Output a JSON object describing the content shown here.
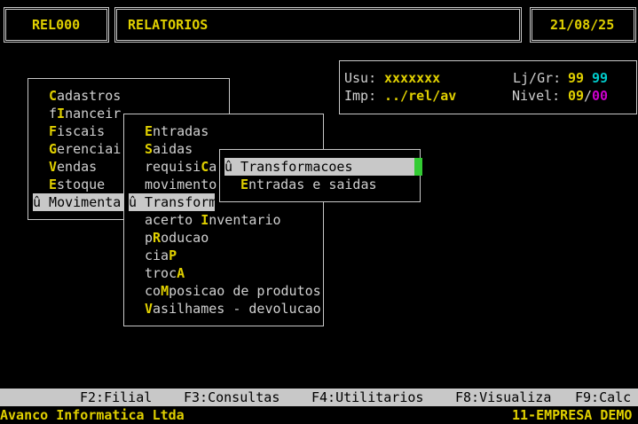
{
  "header": {
    "code": "REL000",
    "title": "RELATORIOS",
    "date": "21/08/25"
  },
  "user_panel": {
    "usu_label": "Usu:",
    "usu_value": "xxxxxxx",
    "lj_label": "Lj/Gr:",
    "lj_value": "99",
    "gr_value": "99",
    "imp_label": "Imp:",
    "imp_value": "../rel/av",
    "nivel_label": "Nivel:",
    "nivel_value": "09",
    "nivel_sep": "/",
    "nivel_value2": "00"
  },
  "menu1": {
    "items": [
      {
        "pre": "",
        "hot": "C",
        "post": "adastros"
      },
      {
        "pre": "f",
        "hot": "I",
        "post": "nanceir"
      },
      {
        "pre": "",
        "hot": "F",
        "post": "iscais"
      },
      {
        "pre": "",
        "hot": "G",
        "post": "erenciai"
      },
      {
        "pre": "",
        "hot": "V",
        "post": "endas"
      },
      {
        "pre": "",
        "hot": "E",
        "post": "stoque"
      },
      {
        "pre": "û Movimenta",
        "hot": "",
        "post": ""
      }
    ]
  },
  "menu2": {
    "items": [
      {
        "pre": "",
        "hot": "E",
        "post": "ntradas"
      },
      {
        "pre": "",
        "hot": "S",
        "post": "aidas"
      },
      {
        "pre": "requisi",
        "hot": "C",
        "post": "a"
      },
      {
        "pre": "movimento",
        "hot": "",
        "post": ""
      },
      {
        "pre": "û Transform",
        "hot": "",
        "post": ""
      },
      {
        "pre": "acerto ",
        "hot": "I",
        "post": "nventario"
      },
      {
        "pre": "p",
        "hot": "R",
        "post": "oducao"
      },
      {
        "pre": "cia",
        "hot": "P",
        "post": ""
      },
      {
        "pre": "troc",
        "hot": "A",
        "post": ""
      },
      {
        "pre": "co",
        "hot": "M",
        "post": "posicao de produtos"
      },
      {
        "pre": "",
        "hot": "V",
        "post": "asilhames - devolucao"
      }
    ]
  },
  "menu3": {
    "items": [
      {
        "pre": "û Transformacoes",
        "hot": "",
        "post": ""
      },
      {
        "pre": "",
        "hot": "E",
        "post": "ntradas e saidas"
      }
    ]
  },
  "function_keys": [
    "F2:Filial",
    "F3:Consultas",
    "F4:Utilitarios",
    "F8:Visualiza",
    "F9:Calc"
  ],
  "footer": {
    "company": "Avanco Informatica Ltda",
    "empresa": "11-EMPRESA DEMO"
  },
  "colors": {
    "background": "#000000",
    "highlight": "#e0d000",
    "selection_bg": "#c8c8c8",
    "cursor": "#33cc33",
    "cyan": "#00cccc",
    "magenta": "#cc00cc"
  }
}
